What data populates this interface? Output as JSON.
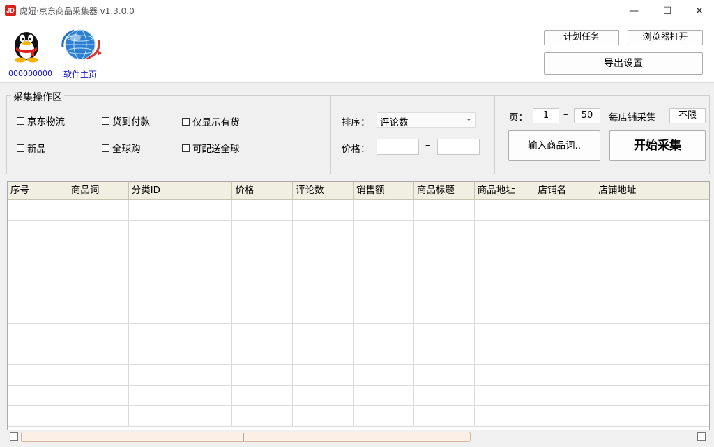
{
  "window": {
    "app_icon_text": "JD",
    "title": "虎妞·京东商品采集器 v1.3.0.0",
    "minimize_glyph": "—",
    "maximize_glyph": "☐",
    "close_glyph": "✕"
  },
  "header": {
    "qq_number": "000000000",
    "homepage_link": "软件主页",
    "buttons": {
      "scheduled_tasks": "计划任务",
      "open_in_browser": "浏览器打开",
      "export_settings": "导出设置"
    }
  },
  "collect_area": {
    "legend": "采集操作区",
    "checkboxes": [
      {
        "label": "京东物流",
        "checked": false
      },
      {
        "label": "货到付款",
        "checked": false
      },
      {
        "label": "仅显示有货",
        "checked": false
      },
      {
        "label": "新品",
        "checked": false
      },
      {
        "label": "全球购",
        "checked": false
      },
      {
        "label": "可配送全球",
        "checked": false
      }
    ],
    "sort_label": "排序：",
    "sort_value": "评论数",
    "price_label": "价格：",
    "price_dash": "–",
    "price_min": "",
    "price_max": "",
    "page_label": "页：",
    "page_from": "1",
    "page_dash": "–",
    "page_to": "50",
    "per_shop_label": "每店铺采集",
    "per_shop_value": "不限",
    "input_keywords_button": "输入商品词..",
    "start_button": "开始采集"
  },
  "table": {
    "columns": [
      "序号",
      "商品词",
      "分类ID",
      "价格",
      "评论数",
      "销售额",
      "商品标题",
      "商品地址",
      "店铺名",
      "店铺地址"
    ],
    "rows": []
  },
  "icons": {
    "qq": "qq-penguin-icon",
    "home": "globe-icon",
    "sort_dropdown": "chevron-down-icon"
  }
}
